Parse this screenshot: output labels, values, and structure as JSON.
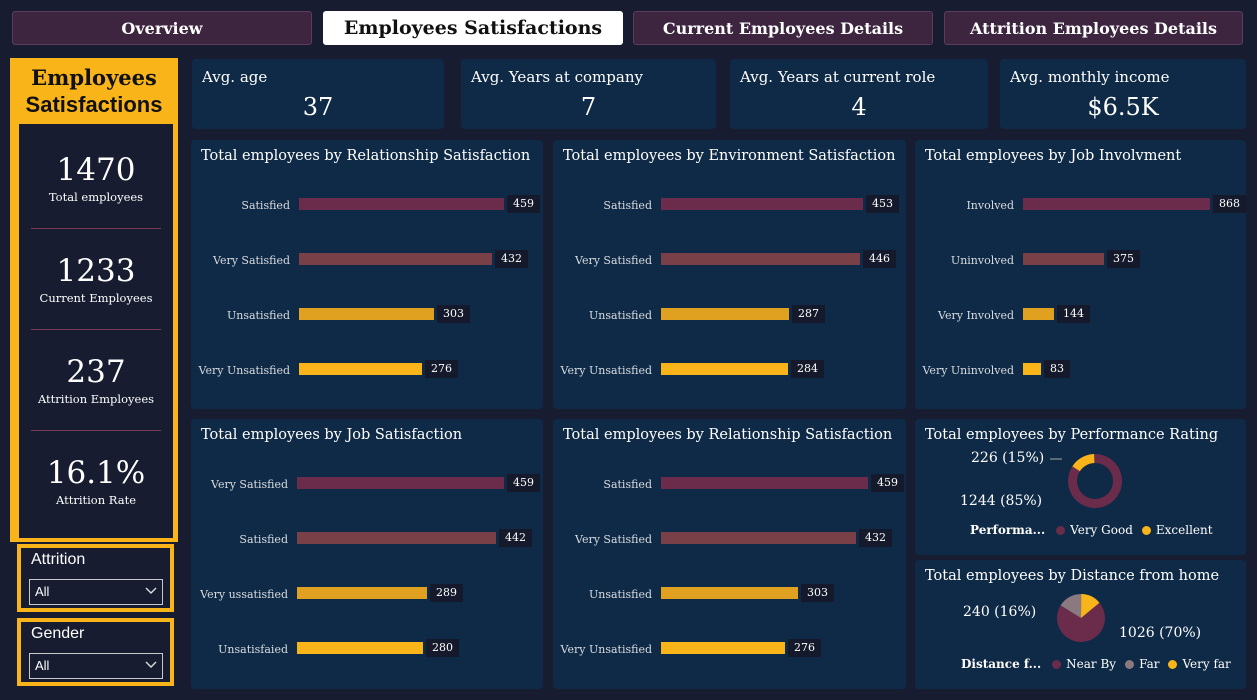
{
  "tabs": [
    "Overview",
    "Employees Satisfactions",
    "Current Employees Details",
    "Attrition Employees Details"
  ],
  "sidebar": {
    "title_line1": "Employees",
    "title_line2": "Satisfactions",
    "kpis": [
      {
        "value": "1470",
        "label": "Total employees"
      },
      {
        "value": "1233",
        "label": "Current Employees"
      },
      {
        "value": "237",
        "label": "Attrition Employees"
      },
      {
        "value": "16.1%",
        "label": "Attrition Rate"
      }
    ],
    "slicers": [
      {
        "title": "Attrition",
        "value": "All"
      },
      {
        "title": "Gender",
        "value": "All"
      }
    ]
  },
  "stats": [
    {
      "title": "Avg. age",
      "value": "37"
    },
    {
      "title": "Avg. Years at company",
      "value": "7"
    },
    {
      "title": "Avg. Years at current role",
      "value": "4"
    },
    {
      "title": "Avg. monthly income",
      "value": "$6.5K"
    }
  ],
  "colors": {
    "purple": "#6b2b4a",
    "brown": "#7a4048",
    "amber": "#e0a020",
    "yellow": "#f9b41a",
    "grey": "#8a7a80"
  },
  "chart_data": [
    {
      "type": "bar",
      "title": "Total employees by Relationship Satisfaction",
      "categories": [
        "Satisfied",
        "Very Satisfied",
        "Unsatisfied",
        "Very Unsatisfied"
      ],
      "values": [
        459,
        432,
        303,
        276
      ]
    },
    {
      "type": "bar",
      "title": "Total employees by Environment Satisfaction",
      "categories": [
        "Satisfied",
        "Very Satisfied",
        "Unsatisfied",
        "Very Unsatisfied"
      ],
      "values": [
        453,
        446,
        287,
        284
      ]
    },
    {
      "type": "bar",
      "title": "Total employees by Job Involvment",
      "categories": [
        "Involved",
        "Uninvolved",
        "Very Involved",
        "Very Uninvolved"
      ],
      "values": [
        868,
        375,
        144,
        83
      ]
    },
    {
      "type": "bar",
      "title": "Total employees by Job Satisfaction",
      "categories": [
        "Very Satisfied",
        "Satisfied",
        "Very ussatisfied",
        "Unsatisfaied"
      ],
      "values": [
        459,
        442,
        289,
        280
      ]
    },
    {
      "type": "bar",
      "title": "Total employees by Relationship Satisfaction",
      "categories": [
        "Satisfied",
        "Very Satisfied",
        "Unsatisfied",
        "Very Unsatisfied"
      ],
      "values": [
        459,
        432,
        303,
        276
      ]
    },
    {
      "type": "pie",
      "title": "Total employees by Performance Rating",
      "legend_title": "Performa...",
      "categories": [
        "Very Good",
        "Excellent"
      ],
      "values": [
        1244,
        226
      ],
      "labels": [
        "1244 (85%)",
        "226 (15%)"
      ]
    },
    {
      "type": "pie",
      "title": "Total employees by Distance from home",
      "legend_title": "Distance f...",
      "categories": [
        "Near By",
        "Far",
        "Very far"
      ],
      "values": [
        1026,
        240,
        204
      ],
      "labels": [
        "1026 (70%)",
        "240 (16%)"
      ]
    }
  ]
}
